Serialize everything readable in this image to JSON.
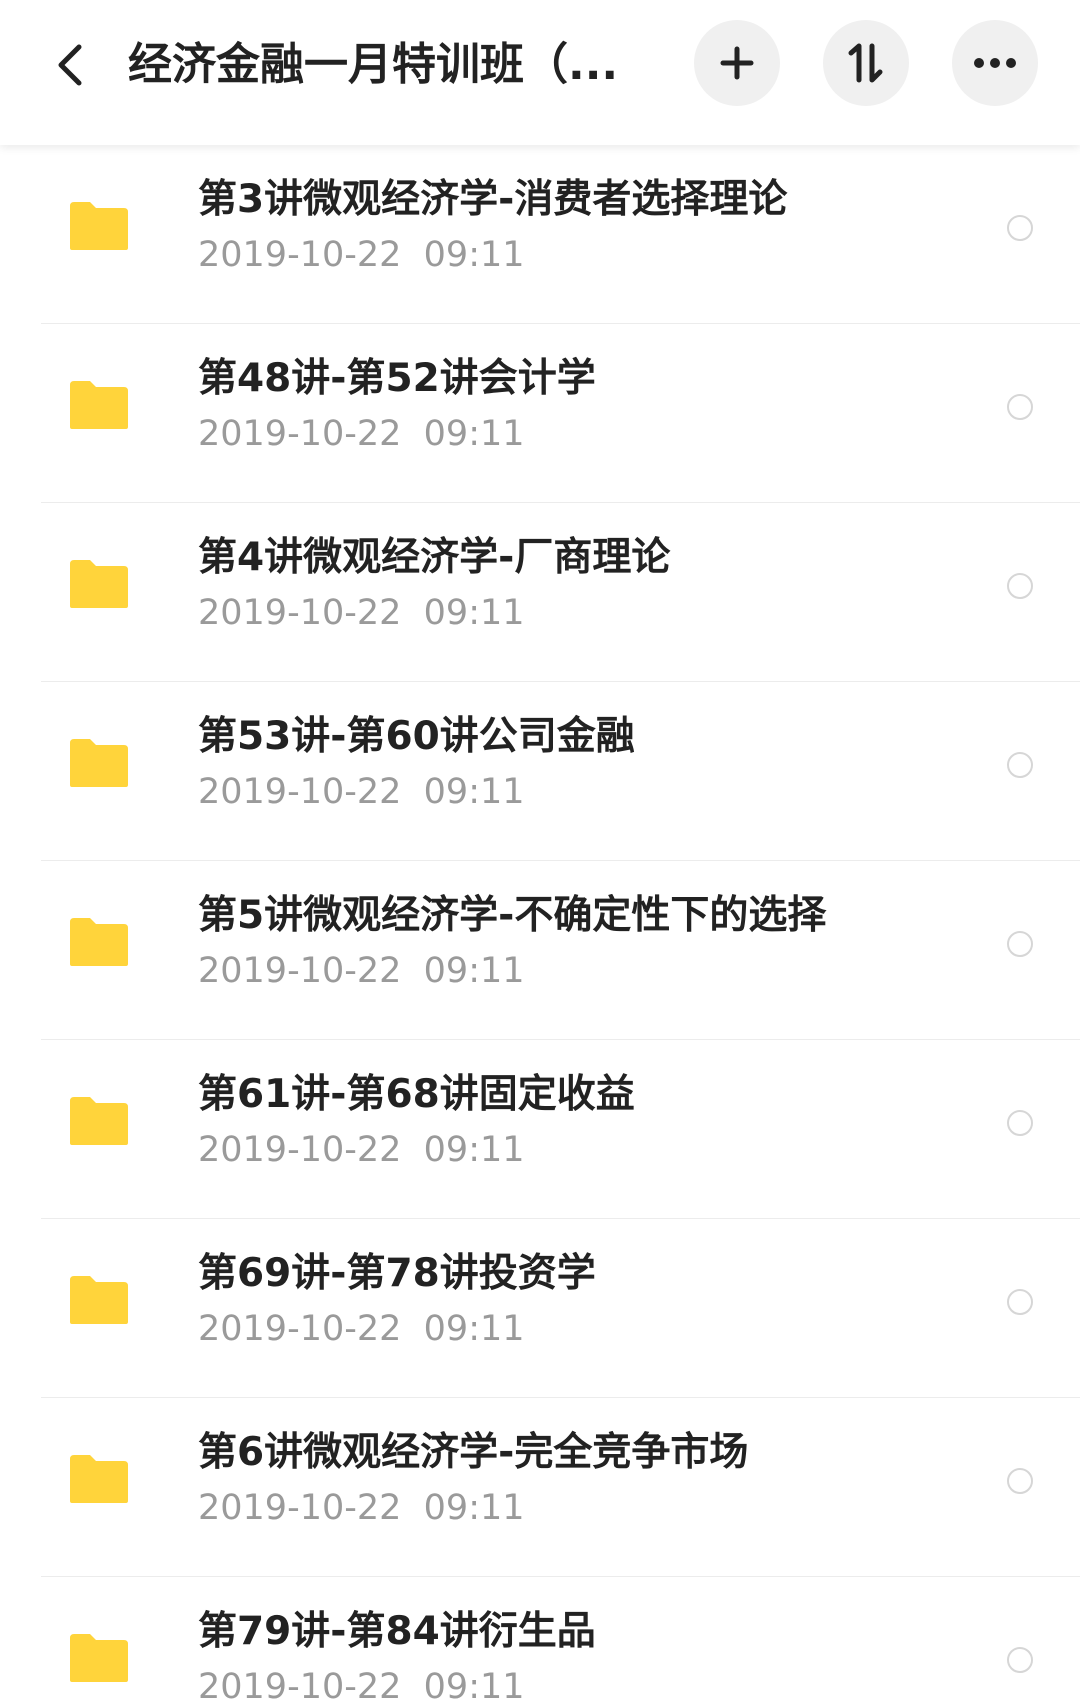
{
  "header": {
    "title": "经济金融一月特训班（...",
    "back_icon": "chevron-left-icon",
    "add_icon": "plus-icon",
    "sort_icon": "sort-icon",
    "more_icon": "more-horizontal-icon"
  },
  "colors": {
    "folder": "#FFD43B",
    "title_text": "#222222",
    "date_text": "#9A9A9A",
    "button_bg": "#F0F0F0"
  },
  "files": [
    {
      "name": "第3讲微观经济学-消费者选择理论",
      "date": "2019-10-22  09:11"
    },
    {
      "name": "第48讲-第52讲会计学",
      "date": "2019-10-22  09:11"
    },
    {
      "name": "第4讲微观经济学-厂商理论",
      "date": "2019-10-22  09:11"
    },
    {
      "name": "第53讲-第60讲公司金融",
      "date": "2019-10-22  09:11"
    },
    {
      "name": "第5讲微观经济学-不确定性下的选择",
      "date": "2019-10-22  09:11"
    },
    {
      "name": "第61讲-第68讲固定收益",
      "date": "2019-10-22  09:11"
    },
    {
      "name": "第69讲-第78讲投资学",
      "date": "2019-10-22  09:11"
    },
    {
      "name": "第6讲微观经济学-完全竞争市场",
      "date": "2019-10-22  09:11"
    },
    {
      "name": "第79讲-第84讲衍生品",
      "date": "2019-10-22  09:11"
    }
  ]
}
